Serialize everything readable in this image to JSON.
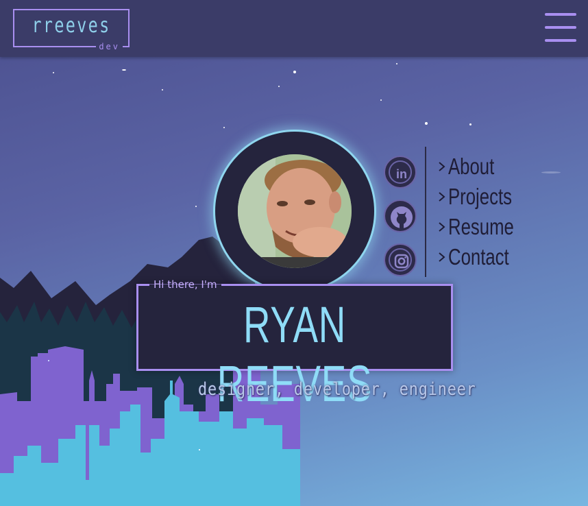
{
  "header": {
    "logo_main": "rreeves",
    "logo_sub": "dev",
    "menu_icon": "hamburger-menu-icon"
  },
  "hero": {
    "greeting": "Hi there, I'm",
    "name": "RYAN REEVES",
    "tagline": "designer, developer, engineer"
  },
  "social": [
    {
      "icon": "linkedin-icon"
    },
    {
      "icon": "github-icon"
    },
    {
      "icon": "instagram-icon"
    }
  ],
  "nav": [
    {
      "label": "About"
    },
    {
      "label": "Projects"
    },
    {
      "label": "Resume"
    },
    {
      "label": "Contact"
    }
  ],
  "colors": {
    "header_bg": "#3b3c68",
    "accent_purple": "#a98ff0",
    "accent_cyan": "#8fdcf7",
    "panel_dark": "#25243d"
  }
}
